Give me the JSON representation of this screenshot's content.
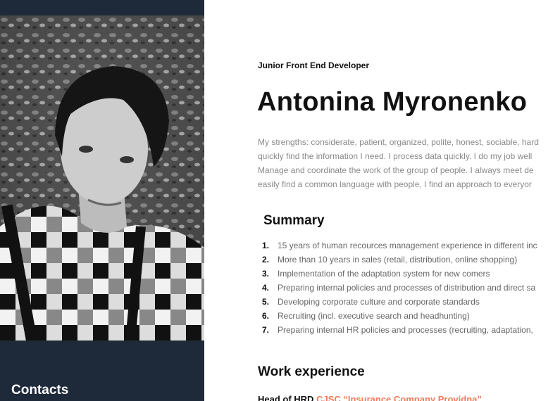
{
  "profile": {
    "job_title": "Junior Front End Developer",
    "name": "Antonina Myronenko",
    "strengths_lines": [
      "My strengths: considerate, patient, organized, polite, honest, sociable, hard",
      "quickly find the information I need. I process data quickly. I do my job well",
      "Manage and coordinate the work of the group of people. I always meet de",
      "easily find a common language with people, I find an approach to everyor"
    ]
  },
  "summary": {
    "title": "Summary",
    "items": [
      {
        "num": "1.",
        "text": "15 years of human recources management experience in different inc"
      },
      {
        "num": "2.",
        "text": "More than 10 years in sales (retail, distribution, online shopping)"
      },
      {
        "num": "3.",
        "text": "Implementation of the adaptation system for new comers"
      },
      {
        "num": "4.",
        "text": "Preparing internal policies and processes of distribution and direct sa"
      },
      {
        "num": "5.",
        "text": "Developing corporate culture and corporate standards"
      },
      {
        "num": "6.",
        "text": "Recruiting (incl. executive search and headhunting)"
      },
      {
        "num": "7.",
        "text": "Preparing internal HR policies and processes (recruiting, adaptation,"
      }
    ]
  },
  "work": {
    "title": "Work experience",
    "first_role": "Head of HRD",
    "first_company": "CJSC “Insurance Company Providna”"
  },
  "sidebar": {
    "contacts_title": "Contacts"
  },
  "colors": {
    "sidebar_bg": "#1e2a3a",
    "accent": "#f07b5a"
  }
}
